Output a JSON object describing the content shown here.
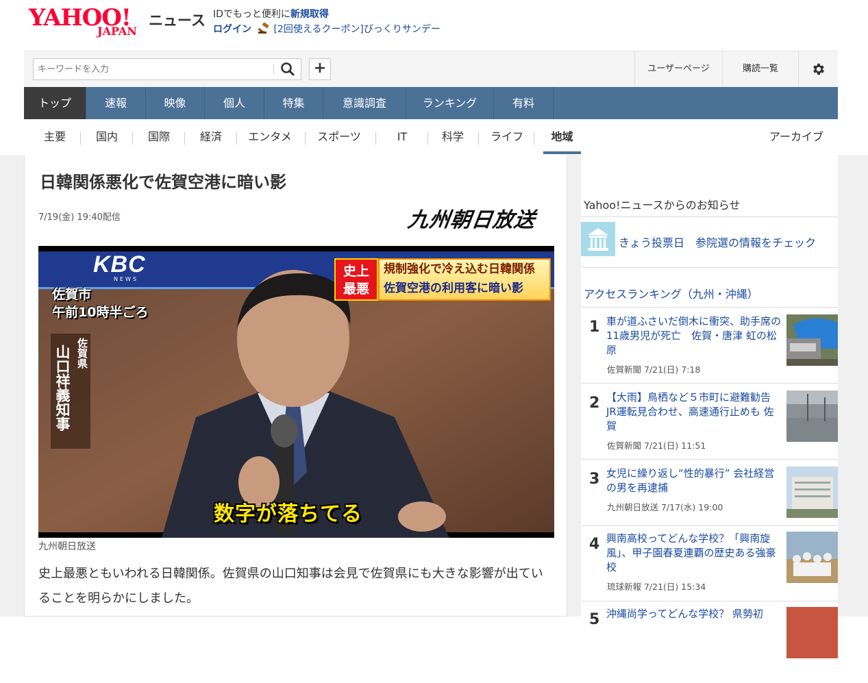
{
  "header": {
    "logo_text": "YAHOO!",
    "logo_sub": "JAPAN",
    "section_name": "ニュース",
    "promo_line1_prefix": "IDでもっと便利に",
    "promo_line1_link": "新規取得",
    "login_label": "ログイン",
    "promo_line2": "[2回使えるクーポン]びっくりサンデー"
  },
  "search": {
    "placeholder": "キーワードを入力",
    "plus_label": "+"
  },
  "toolbar": {
    "user_page": "ユーザーページ",
    "subscriptions": "購読一覧"
  },
  "main_nav": [
    "トップ",
    "速報",
    "映像",
    "個人",
    "特集",
    "意識調査",
    "ランキング",
    "有料"
  ],
  "sub_nav": [
    "主要",
    "国内",
    "国際",
    "経済",
    "エンタメ",
    "スポーツ",
    "IT",
    "科学",
    "ライフ",
    "地域"
  ],
  "archive_label": "アーカイブ",
  "article": {
    "title": "日韓関係悪化で佐賀空港に暗い影",
    "date": "7/19(金) 19:40配信",
    "source_logo": "九州朝日放送",
    "photo": {
      "kbc": "KBC",
      "kbc_news": "NEWS",
      "place": "佐賀市",
      "time": "午前10時半ごろ",
      "role": "佐賀県",
      "name": "山口祥義知事",
      "headline_tag": "史上最悪",
      "headline_1": "規制強化で冷え込む日韓関係",
      "headline_2": "佐賀空港の利用客に暗い影",
      "subtitle": "数字が落ちてる"
    },
    "caption": "九州朝日放送",
    "body": "史上最悪ともいわれる日韓関係。佐賀県の山口知事は会見で佐賀県にも大きな影響が出ていることを明らかにしました。"
  },
  "sidebar": {
    "notice_heading": "Yahoo!ニュースからのお知らせ",
    "notice_text": "きょう投票日　参院選の情報をチェック",
    "ranking_heading": "アクセスランキング（九州・沖縄）",
    "ranking": [
      {
        "num": "1",
        "title": "車が道ふさいだ倒木に衝突、助手席の11歳男児が死亡　佐賀・唐津 虹の松原",
        "meta": "佐賀新聞 7/21(日) 7:18"
      },
      {
        "num": "2",
        "title": "【大雨】鳥栖など５市町に避難勧告 JR運転見合わせ、高速通行止めも 佐賀",
        "meta": "佐賀新聞 7/21(日) 11:51"
      },
      {
        "num": "3",
        "title": "女児に繰り返し“性的暴行” 会社経営の男を再逮捕",
        "meta": "九州朝日放送 7/17(水) 19:00"
      },
      {
        "num": "4",
        "title": "興南高校ってどんな学校？「興南旋風」、甲子園春夏連覇の歴史ある強豪校",
        "meta": "琉球新報 7/21(日) 15:34"
      },
      {
        "num": "5",
        "title": "沖縄尚学ってどんな学校？ 県勢初",
        "meta": ""
      }
    ]
  },
  "colors": {
    "brand_red": "#ff0033",
    "nav_blue": "#4c7197",
    "link_blue": "#1a4ba0",
    "active_tab": "#3b3b3b"
  }
}
